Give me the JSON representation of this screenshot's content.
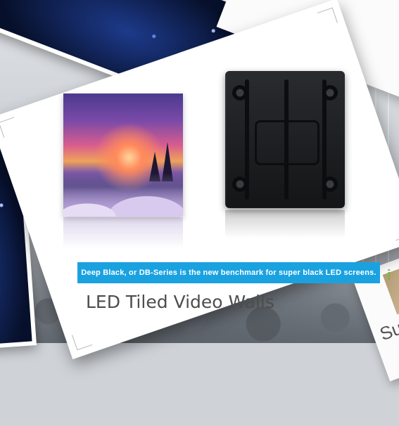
{
  "scene": {
    "banner_text": "Deep Black, or DB-Series is the new benchmark for super black LED screens.",
    "main_title": "LED Tiled Video Walls",
    "side_title_partial": "Su"
  },
  "icons": [
    "led-photo",
    "sunset-led-tile",
    "led-cabinet"
  ],
  "colors": {
    "banner": "#1aa2e0",
    "title": "#4d4d4d",
    "card": "#ffffff"
  }
}
